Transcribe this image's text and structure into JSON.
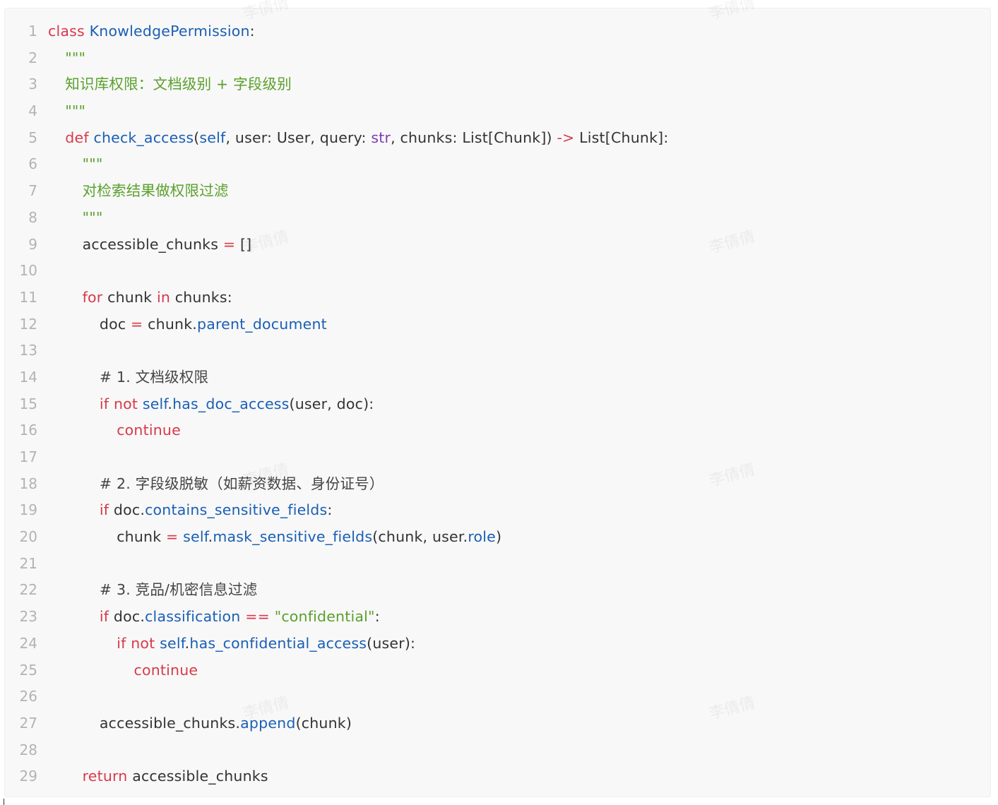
{
  "watermark_text": "李倩倩",
  "code": {
    "lines": [
      {
        "n": "1",
        "indent": 0,
        "tokens": [
          {
            "t": "class",
            "c": "keyword"
          },
          {
            "t": " ",
            "c": "text"
          },
          {
            "t": "KnowledgePermission",
            "c": "cls"
          },
          {
            "t": ":",
            "c": "text"
          }
        ]
      },
      {
        "n": "2",
        "indent": 1,
        "tokens": [
          {
            "t": "\"\"\"",
            "c": "string"
          }
        ]
      },
      {
        "n": "3",
        "indent": 1,
        "tokens": [
          {
            "t": "知识库权限：文档级别 + 字段级别",
            "c": "string"
          }
        ]
      },
      {
        "n": "4",
        "indent": 1,
        "tokens": [
          {
            "t": "\"\"\"",
            "c": "string"
          }
        ]
      },
      {
        "n": "5",
        "indent": 1,
        "tokens": [
          {
            "t": "def",
            "c": "keyword"
          },
          {
            "t": " ",
            "c": "text"
          },
          {
            "t": "check_access",
            "c": "func"
          },
          {
            "t": "(",
            "c": "text"
          },
          {
            "t": "self",
            "c": "attr"
          },
          {
            "t": ", user: User, query: ",
            "c": "text"
          },
          {
            "t": "str",
            "c": "builtin"
          },
          {
            "t": ", chunks: List[Chunk]) ",
            "c": "text"
          },
          {
            "t": "->",
            "c": "operator"
          },
          {
            "t": " List[Chunk]:",
            "c": "text"
          }
        ]
      },
      {
        "n": "6",
        "indent": 2,
        "tokens": [
          {
            "t": "\"\"\"",
            "c": "string"
          }
        ]
      },
      {
        "n": "7",
        "indent": 2,
        "tokens": [
          {
            "t": "对检索结果做权限过滤",
            "c": "string"
          }
        ]
      },
      {
        "n": "8",
        "indent": 2,
        "tokens": [
          {
            "t": "\"\"\"",
            "c": "string"
          }
        ]
      },
      {
        "n": "9",
        "indent": 2,
        "tokens": [
          {
            "t": "accessible_chunks ",
            "c": "text"
          },
          {
            "t": "=",
            "c": "operator"
          },
          {
            "t": " []",
            "c": "text"
          }
        ]
      },
      {
        "n": "10",
        "indent": 0,
        "tokens": []
      },
      {
        "n": "11",
        "indent": 2,
        "tokens": [
          {
            "t": "for",
            "c": "keyword"
          },
          {
            "t": " chunk ",
            "c": "text"
          },
          {
            "t": "in",
            "c": "keyword"
          },
          {
            "t": " chunks:",
            "c": "text"
          }
        ]
      },
      {
        "n": "12",
        "indent": 3,
        "tokens": [
          {
            "t": "doc ",
            "c": "text"
          },
          {
            "t": "=",
            "c": "operator"
          },
          {
            "t": " chunk.",
            "c": "text"
          },
          {
            "t": "parent_document",
            "c": "attr"
          }
        ]
      },
      {
        "n": "13",
        "indent": 0,
        "tokens": []
      },
      {
        "n": "14",
        "indent": 3,
        "tokens": [
          {
            "t": "# 1. 文档级权限",
            "c": "comment"
          }
        ]
      },
      {
        "n": "15",
        "indent": 3,
        "tokens": [
          {
            "t": "if",
            "c": "keyword"
          },
          {
            "t": " ",
            "c": "text"
          },
          {
            "t": "not",
            "c": "keyword"
          },
          {
            "t": " ",
            "c": "text"
          },
          {
            "t": "self",
            "c": "attr"
          },
          {
            "t": ".",
            "c": "text"
          },
          {
            "t": "has_doc_access",
            "c": "func"
          },
          {
            "t": "(user, doc):",
            "c": "text"
          }
        ]
      },
      {
        "n": "16",
        "indent": 4,
        "tokens": [
          {
            "t": "continue",
            "c": "keyword"
          }
        ]
      },
      {
        "n": "17",
        "indent": 0,
        "tokens": []
      },
      {
        "n": "18",
        "indent": 3,
        "tokens": [
          {
            "t": "# 2. 字段级脱敏（如薪资数据、身份证号）",
            "c": "comment"
          }
        ]
      },
      {
        "n": "19",
        "indent": 3,
        "tokens": [
          {
            "t": "if",
            "c": "keyword"
          },
          {
            "t": " doc.",
            "c": "text"
          },
          {
            "t": "contains_sensitive_fields",
            "c": "attr"
          },
          {
            "t": ":",
            "c": "text"
          }
        ]
      },
      {
        "n": "20",
        "indent": 4,
        "tokens": [
          {
            "t": "chunk ",
            "c": "text"
          },
          {
            "t": "=",
            "c": "operator"
          },
          {
            "t": " ",
            "c": "text"
          },
          {
            "t": "self",
            "c": "attr"
          },
          {
            "t": ".",
            "c": "text"
          },
          {
            "t": "mask_sensitive_fields",
            "c": "func"
          },
          {
            "t": "(chunk, user.",
            "c": "text"
          },
          {
            "t": "role",
            "c": "attr"
          },
          {
            "t": ")",
            "c": "text"
          }
        ]
      },
      {
        "n": "21",
        "indent": 0,
        "tokens": []
      },
      {
        "n": "22",
        "indent": 3,
        "tokens": [
          {
            "t": "# 3. 竞品/机密信息过滤",
            "c": "comment"
          }
        ]
      },
      {
        "n": "23",
        "indent": 3,
        "tokens": [
          {
            "t": "if",
            "c": "keyword"
          },
          {
            "t": " doc.",
            "c": "text"
          },
          {
            "t": "classification",
            "c": "attr"
          },
          {
            "t": " ",
            "c": "text"
          },
          {
            "t": "==",
            "c": "operator"
          },
          {
            "t": " ",
            "c": "text"
          },
          {
            "t": "\"confidential\"",
            "c": "string"
          },
          {
            "t": ":",
            "c": "text"
          }
        ]
      },
      {
        "n": "24",
        "indent": 4,
        "tokens": [
          {
            "t": "if",
            "c": "keyword"
          },
          {
            "t": " ",
            "c": "text"
          },
          {
            "t": "not",
            "c": "keyword"
          },
          {
            "t": " ",
            "c": "text"
          },
          {
            "t": "self",
            "c": "attr"
          },
          {
            "t": ".",
            "c": "text"
          },
          {
            "t": "has_confidential_access",
            "c": "func"
          },
          {
            "t": "(user):",
            "c": "text"
          }
        ]
      },
      {
        "n": "25",
        "indent": 5,
        "tokens": [
          {
            "t": "continue",
            "c": "keyword"
          }
        ]
      },
      {
        "n": "26",
        "indent": 0,
        "tokens": []
      },
      {
        "n": "27",
        "indent": 3,
        "tokens": [
          {
            "t": "accessible_chunks.",
            "c": "text"
          },
          {
            "t": "append",
            "c": "func"
          },
          {
            "t": "(chunk)",
            "c": "text"
          }
        ]
      },
      {
        "n": "28",
        "indent": 0,
        "tokens": []
      },
      {
        "n": "29",
        "indent": 2,
        "tokens": [
          {
            "t": "return",
            "c": "keyword"
          },
          {
            "t": " accessible_chunks",
            "c": "text"
          }
        ]
      }
    ]
  }
}
